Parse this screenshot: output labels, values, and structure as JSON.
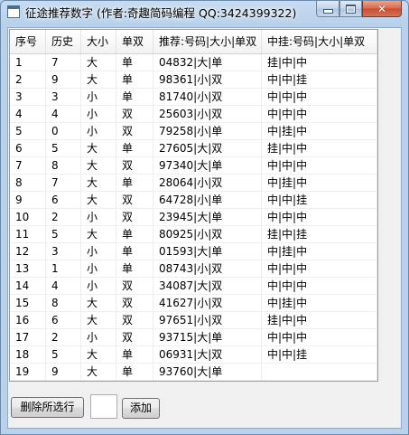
{
  "window": {
    "title": "征途推荐数字 (作者:奇趣简码编程 QQ:3424399322)",
    "controls": {
      "minimize": "minimize-icon",
      "maximize": "maximize-icon",
      "close": "close-icon"
    }
  },
  "table": {
    "columns": [
      "序号",
      "历史",
      "大小",
      "单双",
      "推荐:号码|大小|单双",
      "中挂:号码|大小|单双"
    ],
    "rows": [
      [
        "1",
        "7",
        "大",
        "单",
        "04832|大|单",
        "挂|中|中"
      ],
      [
        "2",
        "9",
        "大",
        "单",
        "98361|小|双",
        "中|中|挂"
      ],
      [
        "3",
        "3",
        "小",
        "单",
        "81740|小|双",
        "中|中|中"
      ],
      [
        "4",
        "4",
        "小",
        "双",
        "25603|小|双",
        "中|中|中"
      ],
      [
        "5",
        "0",
        "小",
        "双",
        "79258|小|单",
        "中|挂|中"
      ],
      [
        "6",
        "5",
        "大",
        "单",
        "27605|大|双",
        "挂|中|中"
      ],
      [
        "7",
        "8",
        "大",
        "双",
        "97340|大|单",
        "中|中|中"
      ],
      [
        "8",
        "7",
        "大",
        "单",
        "28064|小|双",
        "中|挂|中"
      ],
      [
        "9",
        "6",
        "大",
        "双",
        "64728|小|单",
        "中|中|挂"
      ],
      [
        "10",
        "2",
        "小",
        "双",
        "23945|大|单",
        "中|中|中"
      ],
      [
        "11",
        "5",
        "大",
        "单",
        "80925|小|双",
        "挂|中|挂"
      ],
      [
        "12",
        "3",
        "小",
        "单",
        "01593|大|单",
        "中|挂|中"
      ],
      [
        "13",
        "1",
        "小",
        "单",
        "08743|小|双",
        "中|中|中"
      ],
      [
        "14",
        "4",
        "小",
        "双",
        "34087|大|双",
        "中|中|中"
      ],
      [
        "15",
        "8",
        "大",
        "双",
        "41627|小|双",
        "中|挂|中"
      ],
      [
        "16",
        "6",
        "大",
        "双",
        "97651|小|双",
        "挂|中|中"
      ],
      [
        "17",
        "2",
        "小",
        "双",
        "93715|大|单",
        "中|中|中"
      ],
      [
        "18",
        "5",
        "大",
        "单",
        "06931|大|双",
        "中|中|挂"
      ],
      [
        "19",
        "9",
        "大",
        "单",
        "93760|大|单",
        ""
      ]
    ]
  },
  "actions": {
    "delete_label": "删除所选行",
    "add_label": "添加",
    "add_input_value": ""
  }
}
